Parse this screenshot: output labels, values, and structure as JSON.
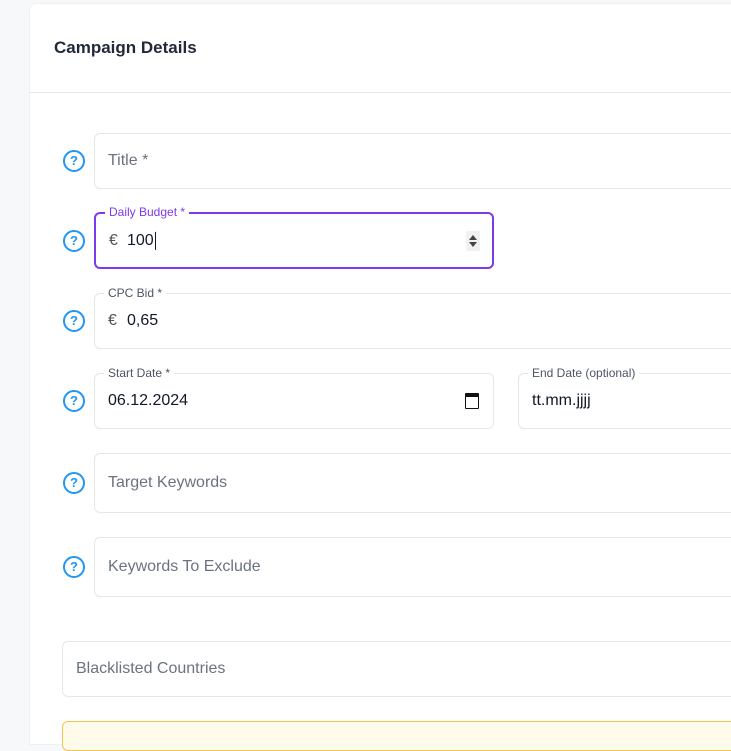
{
  "card": {
    "title": "Campaign Details"
  },
  "form": {
    "title": {
      "placeholder": "Title *"
    },
    "daily_budget": {
      "label": "Daily Budget *",
      "currency": "€",
      "value": "100"
    },
    "cpc_bid": {
      "label": "CPC Bid *",
      "currency": "€",
      "value": "0,65"
    },
    "start_date": {
      "label": "Start Date *",
      "value": "06.12.2024"
    },
    "end_date": {
      "label": "End Date (optional)",
      "value": "tt.mm.jjjj"
    },
    "target_keywords": {
      "placeholder": "Target Keywords"
    },
    "keywords_exclude": {
      "placeholder": "Keywords To Exclude"
    },
    "blacklisted_countries": {
      "placeholder": "Blacklisted Countries"
    }
  },
  "icons": {
    "help": "?"
  },
  "colors": {
    "focus": "#7c3aed",
    "help_icon": "#2196f3",
    "warning_border": "#f6c453"
  }
}
